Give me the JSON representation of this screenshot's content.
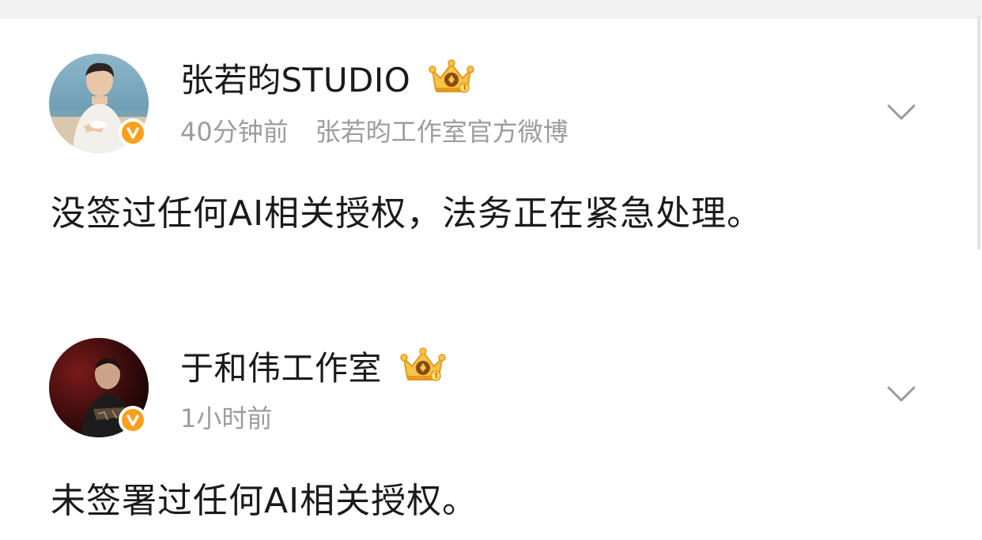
{
  "posts": [
    {
      "author": "张若昀STUDIO",
      "time": "40分钟前",
      "source": "张若昀工作室官方微博",
      "text": "没签过任何AI相关授权，法务正在紧急处理。",
      "badge_icon": "crown-icon",
      "verified_icon": "verified-v-icon",
      "menu_icon": "chevron-down-icon"
    },
    {
      "author": "于和伟工作室",
      "time": "1小时前",
      "source": "",
      "text": "未签署过任何AI相关授权。",
      "badge_icon": "crown-icon",
      "verified_icon": "verified-v-icon",
      "menu_icon": "chevron-down-icon"
    }
  ],
  "colors": {
    "name_text": "#1a1a1a",
    "meta_text": "#9c9c9c",
    "verified_badge": "#ff9f1a",
    "crown": "#f2b633"
  }
}
